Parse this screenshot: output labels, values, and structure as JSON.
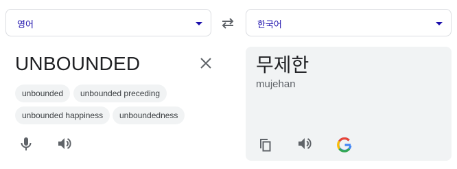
{
  "source_language": {
    "label": "영어"
  },
  "target_language": {
    "label": "한국어"
  },
  "source": {
    "text": "UNBOUNDED",
    "suggestions": [
      "unbounded",
      "unbounded preceding",
      "unbounded happiness",
      "unboundedness"
    ]
  },
  "target": {
    "text": "무제한",
    "transliteration": "mujehan"
  },
  "colors": {
    "language_label": "#1a0dab",
    "panel_background": "#f1f3f4",
    "icon": "#5f6368"
  },
  "icons": [
    "swap-languages-icon",
    "clear-icon",
    "microphone-icon",
    "speaker-icon",
    "copy-icon",
    "google-logo-icon"
  ]
}
